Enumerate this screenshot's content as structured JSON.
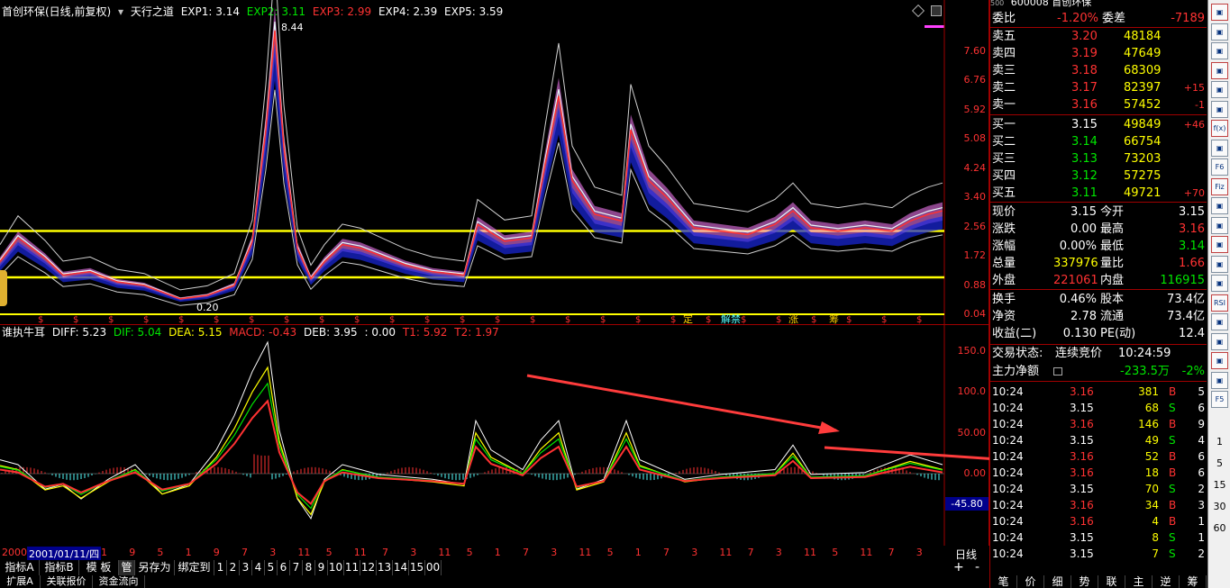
{
  "main_legend": {
    "title": "首创环保(日线,前复权)",
    "indicator": "天行之道",
    "exp1": "EXP1: 3.14",
    "exp2": "EXP2: 3.11",
    "exp3": "EXP3: 2.99",
    "exp4": "EXP4: 2.39",
    "exp5": "EXP5: 3.59"
  },
  "price_axis": [
    "7.60",
    "6.76",
    "5.92",
    "5.08",
    "4.24",
    "3.40",
    "2.56",
    "1.72",
    "0.88",
    "0.04"
  ],
  "price_max_label": "8.44",
  "price_min_label": "0.20",
  "sub_legend": {
    "name": "谁执牛耳",
    "diff": "DIFF: 5.23",
    "dif": "DIF: 5.04",
    "dea": "DEA: 5.15",
    "macd": "MACD: -0.43",
    "deb": "DEB: 3.95",
    "blank": ": 0.00",
    "t1": "T1: 5.92",
    "t2": "T2: 1.97"
  },
  "sub_axis": [
    "150.0",
    "100.0",
    "50.00",
    "0.00"
  ],
  "sub_neg_label": "-45.80",
  "date_axis": {
    "start": "2000",
    "cursor": "2001/01/11/四",
    "ticks": [
      "1",
      "9",
      "5",
      "1",
      "9",
      "7",
      "3",
      "11",
      "5",
      "11",
      "7",
      "3",
      "11",
      "5",
      "1",
      "7",
      "3",
      "11",
      "5",
      "1",
      "7",
      "3",
      "11",
      "7",
      "3",
      "11",
      "5",
      "11",
      "7",
      "3"
    ]
  },
  "period": "日线",
  "marker_labels": {
    "ding": "定",
    "jie": "解禁",
    "zhang": "涨",
    "chou": "筹",
    "zeng": "增"
  },
  "chart_data": {
    "type": "line",
    "title": "首创环保(日线,前复权)",
    "ylim": [
      0.04,
      8.44
    ],
    "yticks": [
      7.6,
      6.76,
      5.92,
      5.08,
      4.24,
      3.4,
      2.56,
      1.72,
      0.88,
      0.04
    ],
    "annotations": [
      {
        "label": "8.44",
        "kind": "high"
      },
      {
        "label": "0.20",
        "kind": "low"
      }
    ],
    "horizontal_lines": [
      2.43,
      1.1,
      0.04
    ],
    "sub_ylim": [
      -45.8,
      150.0
    ],
    "sub_yticks": [
      150.0,
      100.0,
      50.0,
      0.0
    ]
  },
  "orderbook": {
    "ratio_label": "委比",
    "ratio_value": "-1.20%",
    "diff_label": "委差",
    "diff_value": "-7189",
    "asks": [
      {
        "label": "卖五",
        "price": "3.20",
        "vol": "48184",
        "chg": ""
      },
      {
        "label": "卖四",
        "price": "3.19",
        "vol": "47649",
        "chg": ""
      },
      {
        "label": "卖三",
        "price": "3.18",
        "vol": "68309",
        "chg": ""
      },
      {
        "label": "卖二",
        "price": "3.17",
        "vol": "82397",
        "chg": "+15"
      },
      {
        "label": "卖一",
        "price": "3.16",
        "vol": "57452",
        "chg": "-1"
      }
    ],
    "bids": [
      {
        "label": "买一",
        "price": "3.15",
        "vol": "49849",
        "chg": "+46"
      },
      {
        "label": "买二",
        "price": "3.14",
        "vol": "66754",
        "chg": ""
      },
      {
        "label": "买三",
        "price": "3.13",
        "vol": "73203",
        "chg": ""
      },
      {
        "label": "买四",
        "price": "3.12",
        "vol": "57275",
        "chg": ""
      },
      {
        "label": "买五",
        "price": "3.11",
        "vol": "49721",
        "chg": "+70"
      }
    ]
  },
  "quote": [
    {
      "l1": "现价",
      "v1": "3.15",
      "l2": "今开",
      "v2": "3.15",
      "c1": "w",
      "c2": "w"
    },
    {
      "l1": "涨跌",
      "v1": "0.00",
      "l2": "最高",
      "v2": "3.16",
      "c1": "w",
      "c2": "r"
    },
    {
      "l1": "涨幅",
      "v1": "0.00%",
      "l2": "最低",
      "v2": "3.14",
      "c1": "w",
      "c2": "g"
    },
    {
      "l1": "总量",
      "v1": "337976",
      "l2": "量比",
      "v2": "1.66",
      "c1": "y",
      "c2": "r"
    },
    {
      "l1": "外盘",
      "v1": "221061",
      "l2": "内盘",
      "v2": "116915",
      "c1": "r",
      "c2": "g"
    }
  ],
  "quote2": [
    {
      "l1": "换手",
      "v1": "0.46%",
      "l2": "股本",
      "v2": "73.4亿"
    },
    {
      "l1": "净资",
      "v1": "2.78",
      "l2": "流通",
      "v2": "73.4亿"
    },
    {
      "l1": "收益(二)",
      "v1": "0.130",
      "l2": "PE(动)",
      "v2": "12.4"
    }
  ],
  "trade_status": {
    "label": "交易状态:",
    "value": "连续竞价",
    "time": "10:24:59"
  },
  "net_flow": {
    "label": "主力净额",
    "value": "-233.5万",
    "pct": "-2%"
  },
  "ticks": [
    {
      "t": "10:24",
      "p": "3.16",
      "v": "381",
      "s": "B",
      "n": "5"
    },
    {
      "t": "10:24",
      "p": "3.15",
      "v": "68",
      "s": "S",
      "n": "6"
    },
    {
      "t": "10:24",
      "p": "3.16",
      "v": "146",
      "s": "B",
      "n": "9"
    },
    {
      "t": "10:24",
      "p": "3.15",
      "v": "49",
      "s": "S",
      "n": "4"
    },
    {
      "t": "10:24",
      "p": "3.16",
      "v": "52",
      "s": "B",
      "n": "6"
    },
    {
      "t": "10:24",
      "p": "3.16",
      "v": "18",
      "s": "B",
      "n": "6"
    },
    {
      "t": "10:24",
      "p": "3.15",
      "v": "70",
      "s": "S",
      "n": "2"
    },
    {
      "t": "10:24",
      "p": "3.16",
      "v": "34",
      "s": "B",
      "n": "3"
    },
    {
      "t": "10:24",
      "p": "3.16",
      "v": "4",
      "s": "B",
      "n": "1"
    },
    {
      "t": "10:24",
      "p": "3.15",
      "v": "8",
      "s": "S",
      "n": "1"
    },
    {
      "t": "10:24",
      "p": "3.15",
      "v": "7",
      "s": "S",
      "n": "2"
    }
  ],
  "bottom_tabs": [
    "指标A",
    "指标B",
    "模 板",
    "管理",
    "另存为",
    "绑定到",
    "1",
    "2",
    "3",
    "4",
    "5",
    "6",
    "7",
    "8",
    "9",
    "10",
    "11",
    "12",
    "13",
    "14",
    "15",
    "00"
  ],
  "bottom_tabs2": [
    "扩展A",
    "关联报价",
    "资金流向"
  ],
  "right_tabs": [
    "笔",
    "价",
    "细",
    "势",
    "联",
    "主",
    "逆",
    "筹"
  ],
  "toolbar_numbers": [
    "1",
    "5",
    "15",
    "30",
    "60"
  ],
  "toolbar_labels": [
    "RSI",
    "F5",
    "F6",
    "Fiz",
    "f(x)"
  ],
  "top_code": "600008 首创环保",
  "top_500": "500"
}
